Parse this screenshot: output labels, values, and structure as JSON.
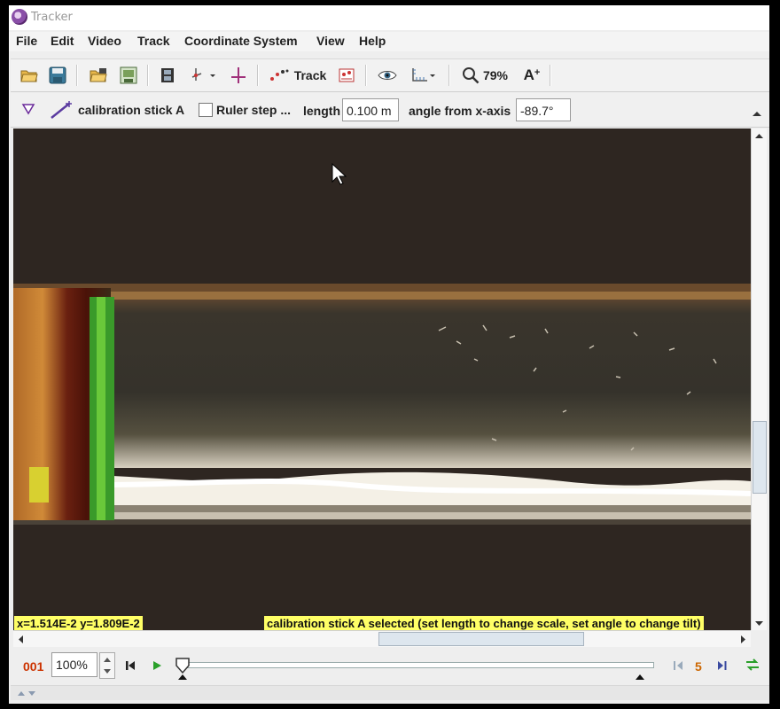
{
  "window": {
    "title": "Tracker"
  },
  "menu": [
    "File",
    "Edit",
    "Video",
    "Track",
    "Coordinate System",
    "View",
    "Help"
  ],
  "toolbar": {
    "track_label": "Track",
    "zoom_value": "79%",
    "font_label": "A"
  },
  "properties": {
    "track_name": "calibration stick A",
    "ruler_step_label": "Ruler step ...",
    "ruler_step_checked": false,
    "length_label": "length",
    "length_value": "0.100 m",
    "angle_label": "angle from x-axis",
    "angle_value": "-89.7°"
  },
  "status": {
    "coords": "x=1.514E-2  y=1.809E-2",
    "message": "calibration stick A selected (set length to change scale, set angle to change tilt)"
  },
  "player": {
    "frame_number": "001",
    "rate_value": "100%",
    "step_size": "5"
  },
  "colors": {
    "readout_bg": "#ffff66",
    "frame_number": "#cc3300",
    "step_size": "#cc6600",
    "play": "#2aa02a"
  }
}
